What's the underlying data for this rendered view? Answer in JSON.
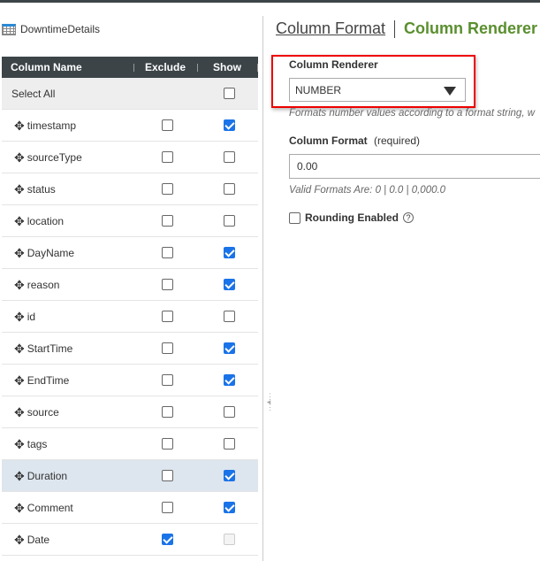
{
  "table_name": "DowntimeDetails",
  "headers": {
    "name": "Column Name",
    "exclude": "Exclude",
    "show": "Show"
  },
  "select_all": "Select All",
  "rows": [
    {
      "name": "timestamp",
      "exclude": false,
      "show": true
    },
    {
      "name": "sourceType",
      "exclude": false,
      "show": false
    },
    {
      "name": "status",
      "exclude": false,
      "show": false
    },
    {
      "name": "location",
      "exclude": false,
      "show": false
    },
    {
      "name": "DayName",
      "exclude": false,
      "show": true
    },
    {
      "name": "reason",
      "exclude": false,
      "show": true
    },
    {
      "name": "id",
      "exclude": false,
      "show": false
    },
    {
      "name": "StartTime",
      "exclude": false,
      "show": true
    },
    {
      "name": "EndTime",
      "exclude": false,
      "show": true
    },
    {
      "name": "source",
      "exclude": false,
      "show": false
    },
    {
      "name": "tags",
      "exclude": false,
      "show": false
    },
    {
      "name": "Duration",
      "exclude": false,
      "show": true,
      "highlighted": true
    },
    {
      "name": "Comment",
      "exclude": false,
      "show": true
    },
    {
      "name": "Date",
      "exclude": true,
      "show": false,
      "show_disabled": true
    }
  ],
  "tabs": {
    "format": "Column Format",
    "renderer": "Column Renderer"
  },
  "renderer": {
    "label": "Column Renderer",
    "value": "NUMBER",
    "help": "Formats number values according to a format string, w"
  },
  "format": {
    "label": "Column Format",
    "required": "(required)",
    "value": "0.00",
    "help": "Valid Formats Are: 0 | 0.0 | 0,000.0"
  },
  "rounding": {
    "label": "Rounding Enabled",
    "checked": false
  }
}
